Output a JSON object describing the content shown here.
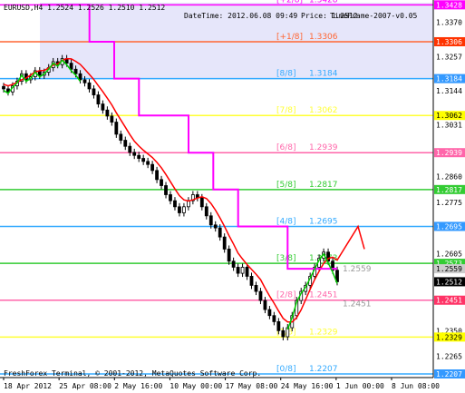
{
  "header": {
    "symbol_line": "EURUSD,H4  1.2524 1.2526 1.2510 1.2512",
    "datetime": "DateTime: 2012.06.08 09:49",
    "price": "Price: 1.2512",
    "timeframe": "TimeFrame-2007-v0.05"
  },
  "footer": {
    "copyright": "FreshForex Terminal, © 2001-2012, MetaQuotes Software Corp."
  },
  "colors": {
    "background": "#ffffff",
    "shaded_zone": "#e6e6fa",
    "red_line": "#ff0000",
    "magenta_line": "#ff00ff",
    "green_line": "#00cc00",
    "candle": "#000000"
  },
  "chart_data": {
    "type": "candlestick",
    "symbol": "EURUSD",
    "timeframe": "H4",
    "ylim": [
      1.2195,
      1.3435
    ],
    "x_tick_labels": [
      "18 Apr 2012",
      "25 Apr 08:00",
      "2 May 16:00",
      "10 May 00:00",
      "17 May 08:00",
      "24 May 16:00",
      "1 Jun 00:00",
      "8 Jun 08:00"
    ],
    "y_tick_labels": [
      {
        "value": 1.337,
        "label": "1.3370"
      },
      {
        "value": 1.3257,
        "label": "1.3257"
      },
      {
        "value": 1.3144,
        "label": "1.3144"
      },
      {
        "value": 1.3031,
        "label": "1.3031"
      },
      {
        "value": 1.286,
        "label": "1.2860"
      },
      {
        "value": 1.2775,
        "label": "1.2775"
      },
      {
        "value": 1.2605,
        "label": "1.2605"
      },
      {
        "value": 1.235,
        "label": "1.2350"
      },
      {
        "value": 1.2265,
        "label": "1.2265"
      }
    ],
    "murrey_levels": [
      {
        "name": "[+2/8]",
        "value": 1.3428,
        "color": "#ff00ff",
        "label_x": 305
      },
      {
        "name": "[+1/8]",
        "value": 1.3306,
        "color": "#ff6633",
        "label_x": 305
      },
      {
        "name": "[8/8]",
        "value": 1.3184,
        "color": "#33aaff",
        "label_x": 305
      },
      {
        "name": "[7/8]",
        "value": 1.3062,
        "color": "#ffff33",
        "label_x": 305
      },
      {
        "name": "[6/8]",
        "value": 1.2939,
        "color": "#ff66aa",
        "label_x": 305
      },
      {
        "name": "[5/8]",
        "value": 1.2817,
        "color": "#33cc33",
        "label_x": 305
      },
      {
        "name": "[4/8]",
        "value": 1.2695,
        "color": "#33aaff",
        "label_x": 305
      },
      {
        "name": "[3/8]",
        "value": 1.2573,
        "color": "#33cc33",
        "label_x": 305
      },
      {
        "name": "[2/8]",
        "value": 1.2451,
        "color": "#ff66aa",
        "label_x": 305
      },
      {
        "name": "[1/8]",
        "value": 1.2329,
        "color": "#ffff33",
        "label_x": 305
      },
      {
        "name": "[0/8]",
        "value": 1.2207,
        "color": "#33aaff",
        "label_x": 305
      }
    ],
    "price_badges": [
      {
        "value": 1.3428,
        "label": "1.3428",
        "bg": "#ff00ff",
        "fg": "#ffffff"
      },
      {
        "value": 1.3306,
        "label": "1.3306",
        "bg": "#ff3300",
        "fg": "#ffffff"
      },
      {
        "value": 1.3184,
        "label": "1.3184",
        "bg": "#3399ff",
        "fg": "#ffffff"
      },
      {
        "value": 1.3062,
        "label": "1.3062",
        "bg": "#ffff00",
        "fg": "#000000"
      },
      {
        "value": 1.2939,
        "label": "1.2939",
        "bg": "#ff66aa",
        "fg": "#ffffff"
      },
      {
        "value": 1.2817,
        "label": "1.2817",
        "bg": "#33cc33",
        "fg": "#ffffff"
      },
      {
        "value": 1.2695,
        "label": "1.2695",
        "bg": "#3399ff",
        "fg": "#ffffff"
      },
      {
        "value": 1.2573,
        "label": "1.2573",
        "bg": "#33cc33",
        "fg": "#ffffff"
      },
      {
        "value": 1.2555,
        "label": "1.2559",
        "bg": "#cccccc",
        "fg": "#000000"
      },
      {
        "value": 1.2512,
        "label": "1.2512",
        "bg": "#000000",
        "fg": "#ffffff"
      },
      {
        "value": 1.2451,
        "label": "1.2451",
        "bg": "#ff3366",
        "fg": "#ffffff"
      },
      {
        "value": 1.2329,
        "label": "1.2329",
        "bg": "#ffff00",
        "fg": "#000000"
      },
      {
        "value": 1.2207,
        "label": "1.2207",
        "bg": "#3399ff",
        "fg": "#ffffff"
      }
    ],
    "inline_labels": [
      {
        "text": "1.2559",
        "value": 1.2555
      },
      {
        "text": "1.2451",
        "value": 1.244
      }
    ],
    "candles_close": [
      1.315,
      1.314,
      1.316,
      1.3175,
      1.32,
      1.318,
      1.319,
      1.321,
      1.3195,
      1.3205,
      1.322,
      1.324,
      1.323,
      1.325,
      1.3235,
      1.3215,
      1.32,
      1.318,
      1.317,
      1.315,
      1.313,
      1.31,
      1.308,
      1.306,
      1.304,
      1.3,
      1.298,
      1.296,
      1.294,
      1.293,
      1.292,
      1.291,
      1.29,
      1.288,
      1.285,
      1.283,
      1.28,
      1.278,
      1.276,
      1.274,
      1.276,
      1.278,
      1.28,
      1.279,
      1.276,
      1.273,
      1.27,
      1.269,
      1.266,
      1.262,
      1.258,
      1.256,
      1.254,
      1.256,
      1.253,
      1.25,
      1.248,
      1.245,
      1.242,
      1.24,
      1.238,
      1.235,
      1.233,
      1.236,
      1.24,
      1.245,
      1.248,
      1.25,
      1.253,
      1.256,
      1.259,
      1.261,
      1.258,
      1.255,
      1.2512
    ]
  }
}
